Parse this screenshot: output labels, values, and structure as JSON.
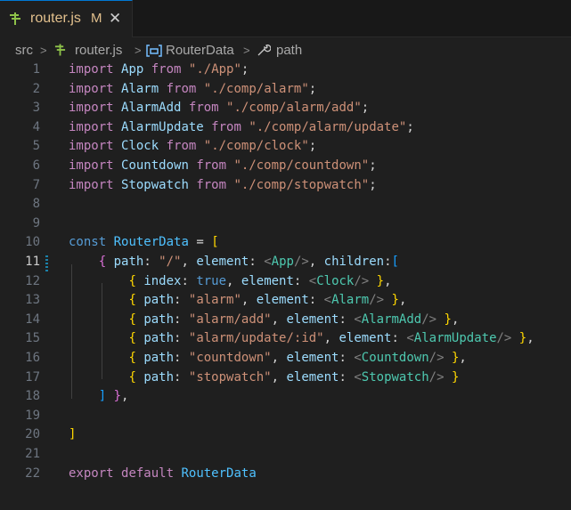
{
  "tab": {
    "title": "router.js",
    "status": "M",
    "close": "✕",
    "icon": "js-file-icon"
  },
  "breadcrumb": {
    "folder": "src",
    "file": "router.js",
    "symbol": "RouterData",
    "property": "path"
  },
  "editor": {
    "active_line": 11,
    "line_numbers": [
      "1",
      "2",
      "3",
      "4",
      "5",
      "6",
      "7",
      "8",
      "9",
      "10",
      "11",
      "12",
      "13",
      "14",
      "15",
      "16",
      "17",
      "18",
      "19",
      "20",
      "21",
      "22"
    ],
    "lines": [
      [
        [
          "kw",
          "import"
        ],
        [
          "pl",
          " "
        ],
        [
          "id",
          "App"
        ],
        [
          "pl",
          " "
        ],
        [
          "kw",
          "from"
        ],
        [
          "pl",
          " "
        ],
        [
          "str",
          "\"./App\""
        ],
        [
          "pl",
          ";"
        ]
      ],
      [
        [
          "kw",
          "import"
        ],
        [
          "pl",
          " "
        ],
        [
          "id",
          "Alarm"
        ],
        [
          "pl",
          " "
        ],
        [
          "kw",
          "from"
        ],
        [
          "pl",
          " "
        ],
        [
          "str",
          "\"./comp/alarm\""
        ],
        [
          "pl",
          ";"
        ]
      ],
      [
        [
          "kw",
          "import"
        ],
        [
          "pl",
          " "
        ],
        [
          "id",
          "AlarmAdd"
        ],
        [
          "pl",
          " "
        ],
        [
          "kw",
          "from"
        ],
        [
          "pl",
          " "
        ],
        [
          "str",
          "\"./comp/alarm/add\""
        ],
        [
          "pl",
          ";"
        ]
      ],
      [
        [
          "kw",
          "import"
        ],
        [
          "pl",
          " "
        ],
        [
          "id",
          "AlarmUpdate"
        ],
        [
          "pl",
          " "
        ],
        [
          "kw",
          "from"
        ],
        [
          "pl",
          " "
        ],
        [
          "str",
          "\"./comp/alarm/update\""
        ],
        [
          "pl",
          ";"
        ]
      ],
      [
        [
          "kw",
          "import"
        ],
        [
          "pl",
          " "
        ],
        [
          "id",
          "Clock"
        ],
        [
          "pl",
          " "
        ],
        [
          "kw",
          "from"
        ],
        [
          "pl",
          " "
        ],
        [
          "str",
          "\"./comp/clock\""
        ],
        [
          "pl",
          ";"
        ]
      ],
      [
        [
          "kw",
          "import"
        ],
        [
          "pl",
          " "
        ],
        [
          "id",
          "Countdown"
        ],
        [
          "pl",
          " "
        ],
        [
          "kw",
          "from"
        ],
        [
          "pl",
          " "
        ],
        [
          "str",
          "\"./comp/countdown\""
        ],
        [
          "pl",
          ";"
        ]
      ],
      [
        [
          "kw",
          "import"
        ],
        [
          "pl",
          " "
        ],
        [
          "id",
          "Stopwatch"
        ],
        [
          "pl",
          " "
        ],
        [
          "kw",
          "from"
        ],
        [
          "pl",
          " "
        ],
        [
          "str",
          "\"./comp/stopwatch\""
        ],
        [
          "pl",
          ";"
        ]
      ],
      [],
      [],
      [
        [
          "dk",
          "const"
        ],
        [
          "pl",
          " "
        ],
        [
          "cst",
          "RouterData"
        ],
        [
          "pl",
          " = "
        ],
        [
          "b1",
          "["
        ]
      ],
      [
        [
          "pl",
          "    "
        ],
        [
          "b2",
          "{"
        ],
        [
          "pl",
          " "
        ],
        [
          "id",
          "path"
        ],
        [
          "pl",
          ": "
        ],
        [
          "str",
          "\"/\""
        ],
        [
          "pl",
          ", "
        ],
        [
          "id",
          "element"
        ],
        [
          "pl",
          ": "
        ],
        [
          "tag",
          "<"
        ],
        [
          "comp",
          "App"
        ],
        [
          "tag",
          "/>"
        ],
        [
          "pl",
          ", "
        ],
        [
          "id",
          "children"
        ],
        [
          "pl",
          ":"
        ],
        [
          "b3",
          "["
        ]
      ],
      [
        [
          "pl",
          "        "
        ],
        [
          "b1",
          "{"
        ],
        [
          "pl",
          " "
        ],
        [
          "id",
          "index"
        ],
        [
          "pl",
          ": "
        ],
        [
          "dk",
          "true"
        ],
        [
          "pl",
          ", "
        ],
        [
          "id",
          "element"
        ],
        [
          "pl",
          ": "
        ],
        [
          "tag",
          "<"
        ],
        [
          "comp",
          "Clock"
        ],
        [
          "tag",
          "/>"
        ],
        [
          "pl",
          " "
        ],
        [
          "b1",
          "}"
        ],
        [
          "pl",
          ","
        ]
      ],
      [
        [
          "pl",
          "        "
        ],
        [
          "b1",
          "{"
        ],
        [
          "pl",
          " "
        ],
        [
          "id",
          "path"
        ],
        [
          "pl",
          ": "
        ],
        [
          "str",
          "\"alarm\""
        ],
        [
          "pl",
          ", "
        ],
        [
          "id",
          "element"
        ],
        [
          "pl",
          ": "
        ],
        [
          "tag",
          "<"
        ],
        [
          "comp",
          "Alarm"
        ],
        [
          "tag",
          "/>"
        ],
        [
          "pl",
          " "
        ],
        [
          "b1",
          "}"
        ],
        [
          "pl",
          ","
        ]
      ],
      [
        [
          "pl",
          "        "
        ],
        [
          "b1",
          "{"
        ],
        [
          "pl",
          " "
        ],
        [
          "id",
          "path"
        ],
        [
          "pl",
          ": "
        ],
        [
          "str",
          "\"alarm/add\""
        ],
        [
          "pl",
          ", "
        ],
        [
          "id",
          "element"
        ],
        [
          "pl",
          ": "
        ],
        [
          "tag",
          "<"
        ],
        [
          "comp",
          "AlarmAdd"
        ],
        [
          "tag",
          "/>"
        ],
        [
          "pl",
          " "
        ],
        [
          "b1",
          "}"
        ],
        [
          "pl",
          ","
        ]
      ],
      [
        [
          "pl",
          "        "
        ],
        [
          "b1",
          "{"
        ],
        [
          "pl",
          " "
        ],
        [
          "id",
          "path"
        ],
        [
          "pl",
          ": "
        ],
        [
          "str",
          "\"alarm/update/:id\""
        ],
        [
          "pl",
          ", "
        ],
        [
          "id",
          "element"
        ],
        [
          "pl",
          ": "
        ],
        [
          "tag",
          "<"
        ],
        [
          "comp",
          "AlarmUpdate"
        ],
        [
          "tag",
          "/>"
        ],
        [
          "pl",
          " "
        ],
        [
          "b1",
          "}"
        ],
        [
          "pl",
          ","
        ]
      ],
      [
        [
          "pl",
          "        "
        ],
        [
          "b1",
          "{"
        ],
        [
          "pl",
          " "
        ],
        [
          "id",
          "path"
        ],
        [
          "pl",
          ": "
        ],
        [
          "str",
          "\"countdown\""
        ],
        [
          "pl",
          ", "
        ],
        [
          "id",
          "element"
        ],
        [
          "pl",
          ": "
        ],
        [
          "tag",
          "<"
        ],
        [
          "comp",
          "Countdown"
        ],
        [
          "tag",
          "/>"
        ],
        [
          "pl",
          " "
        ],
        [
          "b1",
          "}"
        ],
        [
          "pl",
          ","
        ]
      ],
      [
        [
          "pl",
          "        "
        ],
        [
          "b1",
          "{"
        ],
        [
          "pl",
          " "
        ],
        [
          "id",
          "path"
        ],
        [
          "pl",
          ": "
        ],
        [
          "str",
          "\"stopwatch\""
        ],
        [
          "pl",
          ", "
        ],
        [
          "id",
          "element"
        ],
        [
          "pl",
          ": "
        ],
        [
          "tag",
          "<"
        ],
        [
          "comp",
          "Stopwatch"
        ],
        [
          "tag",
          "/>"
        ],
        [
          "pl",
          " "
        ],
        [
          "b1",
          "}"
        ]
      ],
      [
        [
          "pl",
          "    "
        ],
        [
          "b3",
          "]"
        ],
        [
          "pl",
          " "
        ],
        [
          "b2",
          "}"
        ],
        [
          "pl",
          ","
        ]
      ],
      [],
      [
        [
          "b1",
          "]"
        ]
      ],
      [],
      [
        [
          "kw",
          "export"
        ],
        [
          "pl",
          " "
        ],
        [
          "kw",
          "default"
        ],
        [
          "pl",
          " "
        ],
        [
          "cst",
          "RouterData"
        ]
      ]
    ]
  },
  "colors": {
    "accent": "#0078d4",
    "modified": "#e2c08d"
  }
}
